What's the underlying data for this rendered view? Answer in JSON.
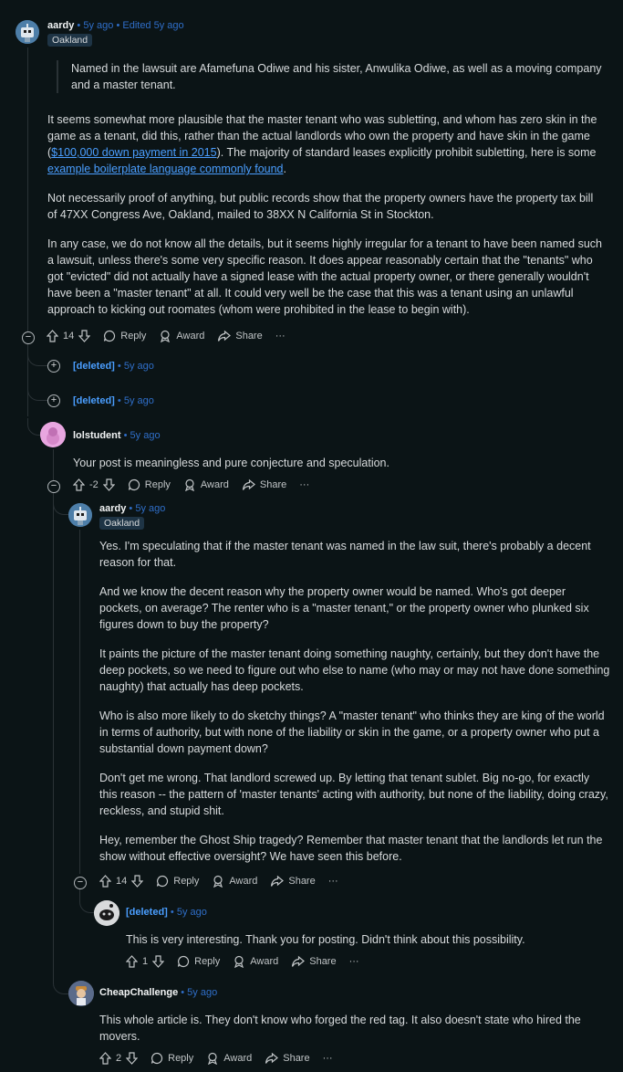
{
  "comments": {
    "c1": {
      "user": "aardy",
      "age": "5y ago",
      "edited": "Edited 5y ago",
      "flair": "Oakland",
      "quote": "Named in the lawsuit are Afamefuna Odiwe and his sister, Anwulika Odiwe, as well as a moving company and a master tenant.",
      "p1_a": "It seems somewhat more plausible that the master tenant who was subletting, and whom has zero skin in the game as a tenant, did this, rather than the actual landlords who own the property and have skin in the game (",
      "p1_link1": "$100,000 down payment in 2015",
      "p1_b": "). The majority of standard leases explicitly prohibit subletting, here is some ",
      "p1_link2": "example boilerplate language commonly found",
      "p1_c": ".",
      "p2": "Not necessarily proof of anything, but public records show that the property owners have the property tax bill of 47XX Congress Ave, Oakland, mailed to 38XX N California St in Stockton.",
      "p3": "In any case, we do not know all the details, but it seems highly irregular for a tenant to have been named such a lawsuit, unless there's some very specific reason. It does appear reasonably certain that the \"tenants\" who got \"evicted\" did not actually have a signed lease with the actual property owner, or there generally wouldn't have been a \"master tenant\" at all. It could very well be the case that this was a tenant using an unlawful approach to kicking out roomates (whom were prohibited in the lease to begin with).",
      "score": "14"
    },
    "d1": {
      "user": "[deleted]",
      "age": "5y ago"
    },
    "d2": {
      "user": "[deleted]",
      "age": "5y ago"
    },
    "c2": {
      "user": "lolstudent",
      "age": "5y ago",
      "text": "Your post is meaningless and pure conjecture and speculation.",
      "score": "-2"
    },
    "c3": {
      "user": "aardy",
      "age": "5y ago",
      "flair": "Oakland",
      "p1": "Yes. I'm speculating that if the master tenant was named in the law suit, there's probably a decent reason for that.",
      "p2": "And we know the decent reason why the property owner would be named. Who's got deeper pockets, on average? The renter who is a \"master tenant,\" or the property owner who plunked six figures down to buy the property?",
      "p3": "It paints the picture of the master tenant doing something naughty, certainly, but they don't have the deep pockets, so we need to figure out who else to name (who may or may not have done something naughty) that actually has deep pockets.",
      "p4": "Who is also more likely to do sketchy things? A \"master tenant\" who thinks they are king of the world in terms of authority, but with none of the liability or skin in the game, or a property owner who put a substantial down payment down?",
      "p5": "Don't get me wrong. That landlord screwed up. By letting that tenant sublet. Big no-go, for exactly this reason -- the pattern of 'master tenants' acting with authority, but none of the liability, doing crazy, reckless, and stupid shit.",
      "p6": "Hey, remember the Ghost Ship tragedy? Remember that master tenant that the landlords let run the show without effective oversight? We have seen this before.",
      "score": "14"
    },
    "c4": {
      "user": "[deleted]",
      "age": "5y ago",
      "text": "This is very interesting. Thank you for posting. Didn't think about this possibility.",
      "score": "1"
    },
    "c5": {
      "user": "CheapChallenge",
      "age": "5y ago",
      "text": "This whole article is. They don't know who forged the red tag. It also doesn't state who hired the movers.",
      "score": "2"
    }
  },
  "actions": {
    "reply": "Reply",
    "award": "Award",
    "share": "Share",
    "more": "···"
  },
  "toggles": {
    "collapse": "−",
    "expand": "+"
  },
  "colors": {
    "background": "#0b1416",
    "link": "#4a9eff",
    "meta": "#2f6ec8",
    "flair_bg": "#1e3445"
  }
}
